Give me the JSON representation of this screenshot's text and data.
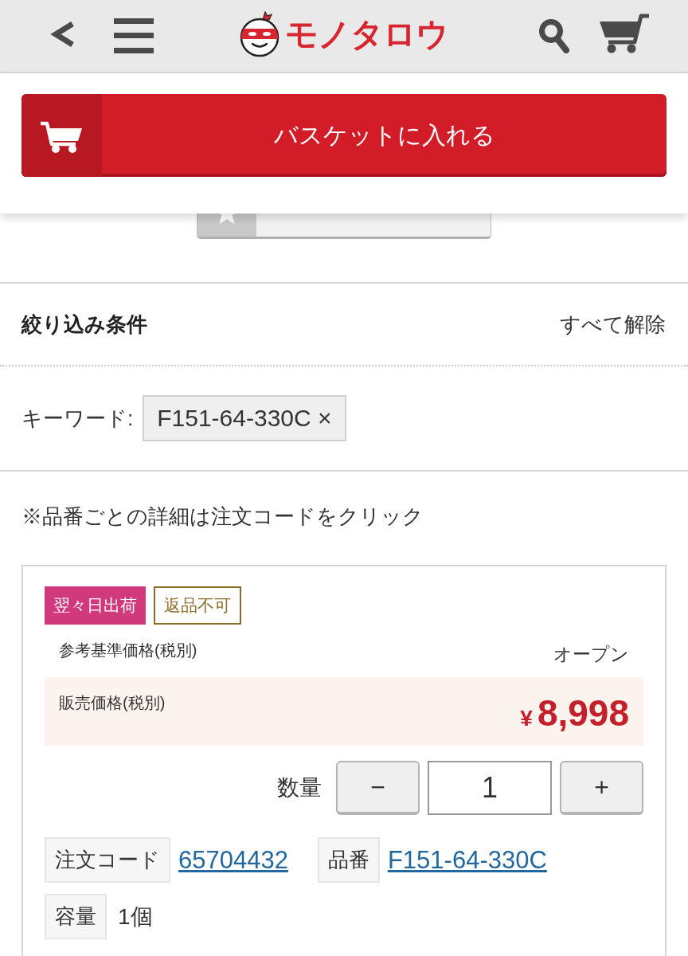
{
  "header": {
    "logo_text": "モノタロウ"
  },
  "sticky_bar": {
    "add_to_basket": "バスケットに入れる"
  },
  "filters": {
    "title": "絞り込み条件",
    "clear_all": "すべて解除",
    "keyword_label": "キーワード:",
    "keyword_chip": "F151-64-330C ×"
  },
  "note": "※品番ごとの詳細は注文コードをクリック",
  "product": {
    "badges": [
      {
        "label": "翌々日出荷",
        "kind": "filled",
        "color": "#d03a7c"
      },
      {
        "label": "返品不可",
        "kind": "outline",
        "color": "#8c6d2c"
      }
    ],
    "reference_price": {
      "label": "参考基準価格(税別)",
      "value": "オープン"
    },
    "sale_price": {
      "label": "販売価格(税別)",
      "currency": "¥",
      "amount": "8,998"
    },
    "quantity": {
      "label": "数量",
      "minus": "−",
      "value": "1",
      "plus": "+"
    },
    "spec_rows": [
      [
        {
          "label": "注文コード",
          "value": "65704432",
          "kind": "link"
        },
        {
          "label": "品番",
          "value": "F151-64-330C",
          "kind": "link"
        }
      ],
      [
        {
          "label": "容量",
          "value": "1個",
          "kind": "text"
        }
      ]
    ]
  }
}
